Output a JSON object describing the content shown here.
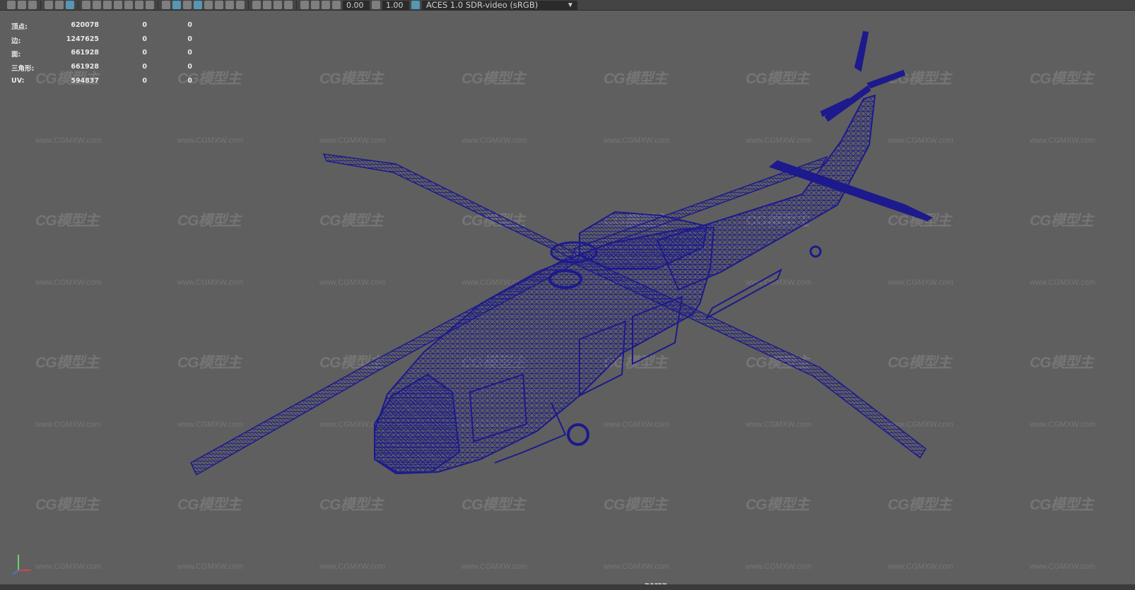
{
  "toolbar": {
    "exposure_value": "0.00",
    "gamma_value": "1.00",
    "color_space": "ACES 1.0 SDR-video (sRGB)"
  },
  "hud": {
    "rows": [
      {
        "label": "顶点:",
        "values": [
          "620078",
          "0",
          "0"
        ]
      },
      {
        "label": "边:",
        "values": [
          "1247625",
          "0",
          "0"
        ]
      },
      {
        "label": "面:",
        "values": [
          "661928",
          "0",
          "0"
        ]
      },
      {
        "label": "三角形:",
        "values": [
          "661928",
          "0",
          "0"
        ]
      },
      {
        "label": "UV:",
        "values": [
          "594837",
          "0",
          "0"
        ]
      }
    ]
  },
  "camera_label": "persp",
  "watermark": {
    "logo": "CG模型主",
    "url": "www.CGMXW.com"
  },
  "colors": {
    "wireframe": "#1c1a8c",
    "background": "#5f5f5f",
    "toolbar": "#444444"
  }
}
